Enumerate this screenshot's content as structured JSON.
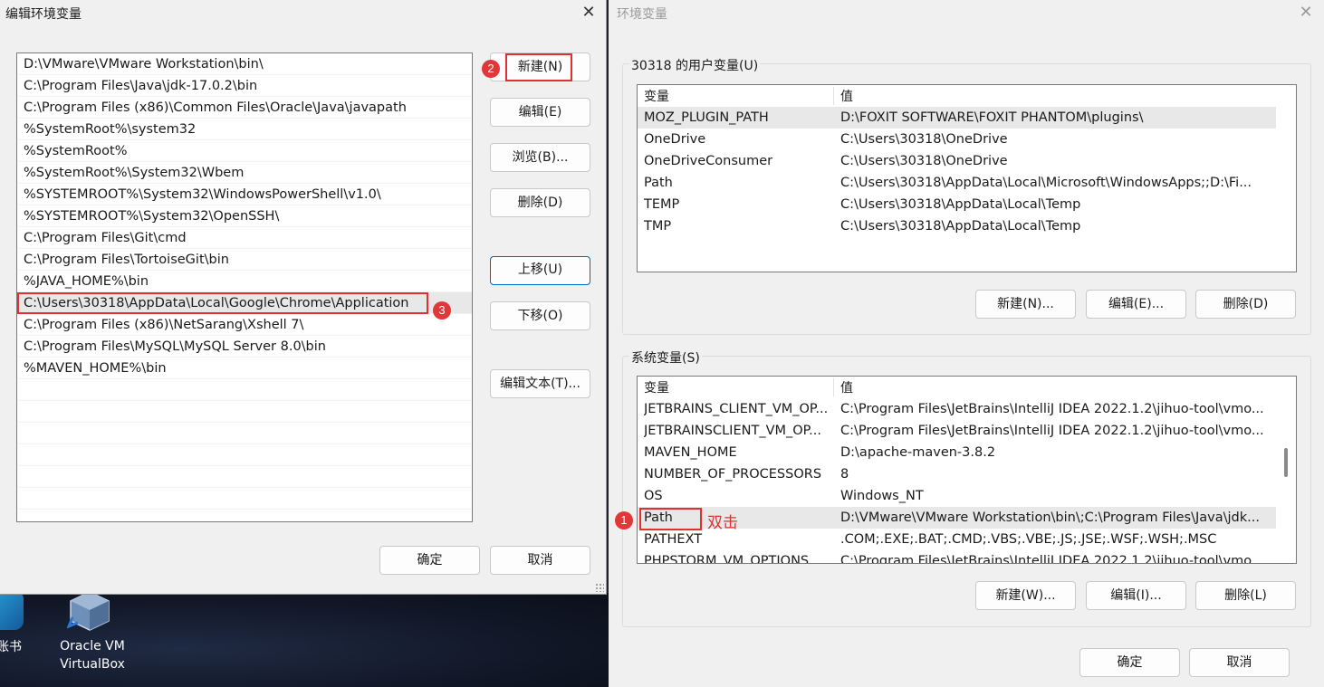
{
  "edit_dialog": {
    "title": "编辑环境变量",
    "close_glyph": "✕",
    "entries": [
      "D:\\VMware\\VMware Workstation\\bin\\",
      "C:\\Program Files\\Java\\jdk-17.0.2\\bin",
      "C:\\Program Files (x86)\\Common Files\\Oracle\\Java\\javapath",
      "%SystemRoot%\\system32",
      "%SystemRoot%",
      "%SystemRoot%\\System32\\Wbem",
      "%SYSTEMROOT%\\System32\\WindowsPowerShell\\v1.0\\",
      "%SYSTEMROOT%\\System32\\OpenSSH\\",
      "C:\\Program Files\\Git\\cmd",
      "C:\\Program Files\\TortoiseGit\\bin",
      "%JAVA_HOME%\\bin",
      "C:\\Users\\30318\\AppData\\Local\\Google\\Chrome\\Application",
      "C:\\Program Files (x86)\\NetSarang\\Xshell 7\\",
      "C:\\Program Files\\MySQL\\MySQL Server 8.0\\bin",
      "%MAVEN_HOME%\\bin"
    ],
    "selected_index": 11,
    "buttons": {
      "new": "新建(N)",
      "edit": "编辑(E)",
      "browse": "浏览(B)...",
      "delete": "删除(D)",
      "move_up": "上移(U)",
      "move_down": "下移(O)",
      "edit_text": "编辑文本(T)...",
      "ok": "确定",
      "cancel": "取消"
    }
  },
  "env_dialog": {
    "title": "环境变量",
    "close_glyph": "✕",
    "user_group_label": "30318 的用户变量(U)",
    "col_variable": "变量",
    "col_value": "值",
    "user_vars": [
      {
        "name": "MOZ_PLUGIN_PATH",
        "value": "D:\\FOXIT SOFTWARE\\FOXIT PHANTOM\\plugins\\"
      },
      {
        "name": "OneDrive",
        "value": "C:\\Users\\30318\\OneDrive"
      },
      {
        "name": "OneDriveConsumer",
        "value": "C:\\Users\\30318\\OneDrive"
      },
      {
        "name": "Path",
        "value": "C:\\Users\\30318\\AppData\\Local\\Microsoft\\WindowsApps;;D:\\Fi..."
      },
      {
        "name": "TEMP",
        "value": "C:\\Users\\30318\\AppData\\Local\\Temp"
      },
      {
        "name": "TMP",
        "value": "C:\\Users\\30318\\AppData\\Local\\Temp"
      }
    ],
    "user_buttons": {
      "new": "新建(N)...",
      "edit": "编辑(E)...",
      "delete": "删除(D)"
    },
    "system_group_label": "系统变量(S)",
    "system_vars": [
      {
        "name": "JETBRAINS_CLIENT_VM_OP...",
        "value": "C:\\Program Files\\JetBrains\\IntelliJ IDEA 2022.1.2\\jihuo-tool\\vmo..."
      },
      {
        "name": "JETBRAINSCLIENT_VM_OP...",
        "value": "C:\\Program Files\\JetBrains\\IntelliJ IDEA 2022.1.2\\jihuo-tool\\vmo..."
      },
      {
        "name": "MAVEN_HOME",
        "value": "D:\\apache-maven-3.8.2"
      },
      {
        "name": "NUMBER_OF_PROCESSORS",
        "value": "8"
      },
      {
        "name": "OS",
        "value": "Windows_NT"
      },
      {
        "name": "Path",
        "value": "D:\\VMware\\VMware Workstation\\bin\\;C:\\Program Files\\Java\\jdk..."
      },
      {
        "name": "PATHEXT",
        "value": ".COM;.EXE;.BAT;.CMD;.VBS;.VBE;.JS;.JSE;.WSF;.WSH;.MSC"
      },
      {
        "name": "PHPSTORM_VM_OPTIONS",
        "value": "C:\\Program Files\\JetBrains\\IntelliJ IDEA 2022.1.2\\jihuo-tool\\vmo..."
      }
    ],
    "system_selected_index": 5,
    "system_scroll_fraction": 0.45,
    "system_buttons": {
      "new": "新建(W)...",
      "edit": "编辑(I)...",
      "delete": "删除(L)"
    },
    "ok": "确定",
    "cancel": "取消"
  },
  "annotations": {
    "step1": "1",
    "step2": "2",
    "step3": "3",
    "double_click": "双击",
    "color": "#e03030"
  },
  "desktop": {
    "left_icon_label": "账书",
    "vbox_label_line1": "Oracle VM",
    "vbox_label_line2": "VirtualBox"
  }
}
